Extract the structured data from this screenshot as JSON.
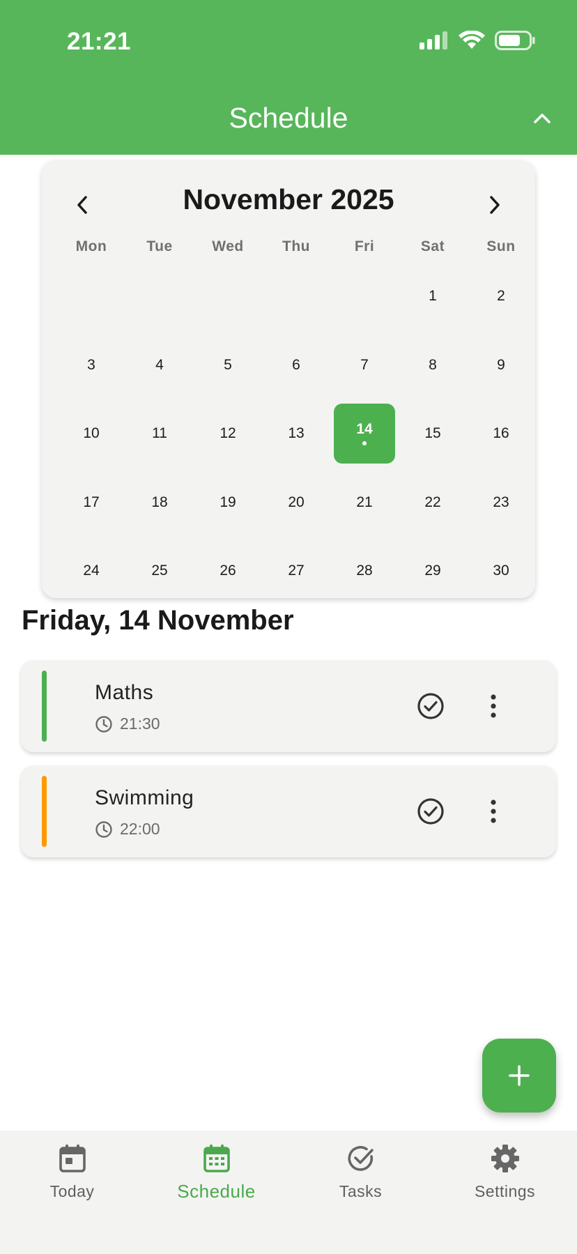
{
  "status_bar": {
    "time": "21:21"
  },
  "app_bar": {
    "title": "Schedule"
  },
  "calendar": {
    "month_title": "November 2025",
    "weekdays": [
      "Mon",
      "Tue",
      "Wed",
      "Thu",
      "Fri",
      "Sat",
      "Sun"
    ],
    "days": [
      "1",
      "2",
      "3",
      "4",
      "5",
      "6",
      "7",
      "8",
      "9",
      "10",
      "11",
      "12",
      "13",
      "14",
      "15",
      "16",
      "17",
      "18",
      "19",
      "20",
      "21",
      "22",
      "23",
      "24",
      "25",
      "26",
      "27",
      "28",
      "29",
      "30"
    ],
    "selected_day": "14",
    "days_with_events": [
      "14"
    ]
  },
  "selected_date_heading": "Friday, 14 November",
  "events": [
    {
      "name": "Maths",
      "time": "21:30",
      "color": "#4caf50"
    },
    {
      "name": "Swimming",
      "time": "22:00",
      "color": "#ff9800"
    }
  ],
  "bottom_nav": {
    "items": [
      {
        "label": "Today",
        "icon": "calendar-today-icon",
        "active": false
      },
      {
        "label": "Schedule",
        "icon": "calendar-month-icon",
        "active": true
      },
      {
        "label": "Tasks",
        "icon": "check-circle-icon",
        "active": false
      },
      {
        "label": "Settings",
        "icon": "gear-icon",
        "active": false
      }
    ]
  },
  "colors": {
    "primary": "#58b65a",
    "accent": "#4db04f",
    "surface": "#f3f4f2"
  }
}
